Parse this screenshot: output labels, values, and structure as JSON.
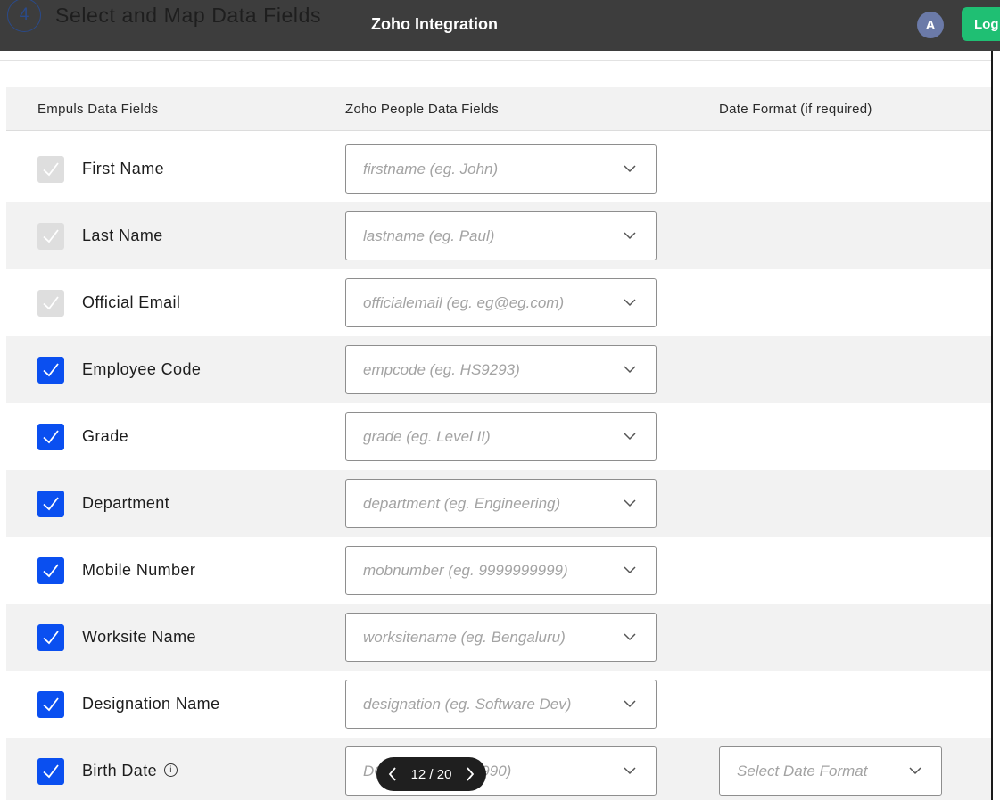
{
  "header": {
    "step_number": "4",
    "step_title": "Select and Map Data Fields",
    "app_title": "Zoho Integration",
    "avatar_initial": "A",
    "logout_label": "Log"
  },
  "table": {
    "columns": [
      "Empuls Data Fields",
      "Zoho People Data Fields",
      "Date Format (if required)"
    ],
    "rows": [
      {
        "label": "First Name",
        "state": "disabled",
        "placeholder": "firstname (eg. John)"
      },
      {
        "label": "Last Name",
        "state": "disabled",
        "placeholder": "lastname (eg. Paul)"
      },
      {
        "label": "Official Email",
        "state": "disabled",
        "placeholder": "officialemail (eg. eg@eg.com)"
      },
      {
        "label": "Employee Code",
        "state": "checked",
        "placeholder": "empcode (eg. HS9293)"
      },
      {
        "label": "Grade",
        "state": "checked",
        "placeholder": "grade (eg. Level II)"
      },
      {
        "label": "Department",
        "state": "checked",
        "placeholder": "department (eg. Engineering)"
      },
      {
        "label": "Mobile Number",
        "state": "checked",
        "placeholder": "mobnumber (eg. 9999999999)"
      },
      {
        "label": "Worksite Name",
        "state": "checked",
        "placeholder": "worksitename (eg. Bengaluru)"
      },
      {
        "label": "Designation Name",
        "state": "checked",
        "placeholder": "designation (eg. Software Dev)"
      },
      {
        "label": "Birth Date",
        "state": "checked",
        "placeholder": "DOB (eg. 01/01/1990)",
        "info_icon": "info-icon",
        "date_format_placeholder": "Select Date Format"
      }
    ]
  },
  "pager": {
    "text": "12 / 20",
    "prev_icon": "chevron-left-icon",
    "next_icon": "chevron-right-icon"
  },
  "colors": {
    "topbar": "#3d3d3d",
    "checked": "#0a4ff0",
    "disabled_checkbox": "#dedede",
    "logout_button": "#1fbf73",
    "avatar": "#6b7aa8",
    "row_alt": "#f2f2f2"
  }
}
